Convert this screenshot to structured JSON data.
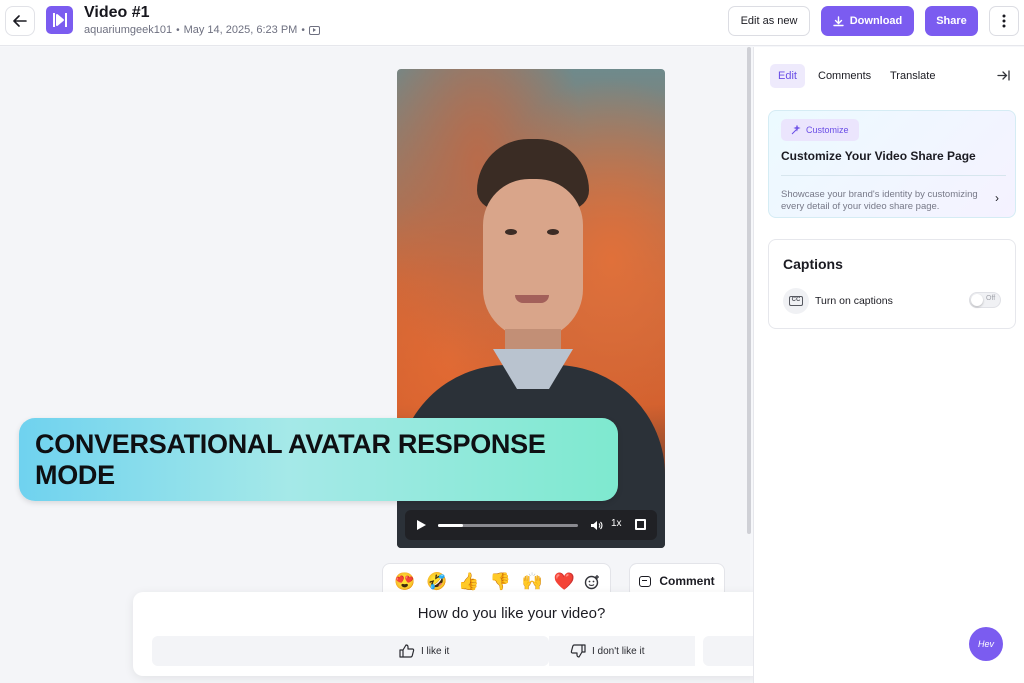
{
  "header": {
    "title": "Video #1",
    "author": "aquariumgeek101",
    "date": "May 14, 2025, 6:23 PM",
    "edit_as_new_label": "Edit as new",
    "download_label": "Download",
    "share_label": "Share",
    "icons": {
      "back": "arrow-left-icon",
      "logo": "heygen-logo-icon",
      "video_meta": "video-icon",
      "more": "more-vertical-icon"
    }
  },
  "player": {
    "speed_label": "1x",
    "progress_fraction": 0.18
  },
  "banner": {
    "text": "CONVERSATIONAL AVATAR RESPONSE MODE"
  },
  "reactions": {
    "emojis": [
      "😍",
      "🤣",
      "👍",
      "👎",
      "🙌",
      "❤️"
    ],
    "add_reaction_icon": "add-reaction-icon"
  },
  "comment": {
    "label": "Comment"
  },
  "feedback": {
    "title": "How do you like your video?",
    "like_label": "I like it",
    "dislike_label": "I don't like it"
  },
  "panel": {
    "tabs": [
      {
        "label": "Edit",
        "active": true
      },
      {
        "label": "Comments",
        "active": false
      },
      {
        "label": "Translate",
        "active": false
      }
    ],
    "customize": {
      "badge": "Customize",
      "title": "Customize Your Video Share Page",
      "description": "Showcase your brand's identity by customizing every detail of your video share page."
    },
    "captions": {
      "title": "Captions",
      "icon_text": "CC",
      "toggle_label": "Turn on captions",
      "toggle_state": "Off"
    }
  },
  "assistant": {
    "label": "Hev"
  },
  "colors": {
    "accent": "#7b5cf0",
    "accent_light": "#eeeafc",
    "banner_start": "#6fd2ef",
    "banner_end": "#7ee9cf"
  }
}
